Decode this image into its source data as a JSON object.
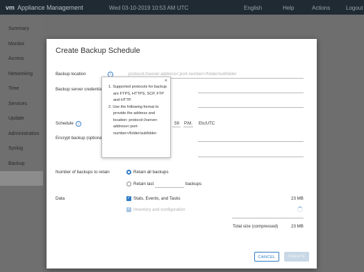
{
  "topbar": {
    "logo": "vm",
    "title": "Appliance Management",
    "time": "Wed 03-10-2019 10:53 AM UTC",
    "language": "English",
    "help": "Help",
    "actions": "Actions",
    "logout": "Logout"
  },
  "sidebar": {
    "items": [
      "Summary",
      "Monitor",
      "Access",
      "Networking",
      "Time",
      "Services",
      "Update",
      "Administration",
      "Syslog",
      "Backup"
    ],
    "active": "Backup"
  },
  "modal": {
    "title": "Create Backup Schedule",
    "backup_location_label": "Backup location",
    "backup_location_placeholder": "protocol://server-address<:port-number>/folder/subfolder",
    "server_credentials_label": "Backup server credentials",
    "schedule_label": "Schedule",
    "schedule_minute": "59",
    "schedule_ampm": "P.M.",
    "schedule_timezone": "Etc/UTC",
    "encrypt_label": "Encrypt backup (optional)",
    "retain_label": "Number of backups to retain",
    "retain_all": "Retain all backups",
    "retain_last": "Retain last",
    "retain_last_suffix": "backups",
    "data_label": "Data",
    "data_items": [
      {
        "label": "Stats, Events, and Tasks",
        "size": "23 MB"
      },
      {
        "label": "Inventory and configuration",
        "size": ""
      }
    ],
    "total_label": "Total size (compressed)",
    "total_size": "23 MB",
    "cancel": "CANCEL",
    "create": "CREATE"
  },
  "tooltip": {
    "close": "×",
    "items": [
      "1. Supported protocols for backup are FTPS, HTTPS, SCP, FTP and HTTP.",
      "2. Use the following format to provide the address and location: protocol://server-address<:port-number>/folder/subfolder"
    ]
  },
  "colors": {
    "accent": "#2e7bc4",
    "topbar": "#1f2a33"
  }
}
